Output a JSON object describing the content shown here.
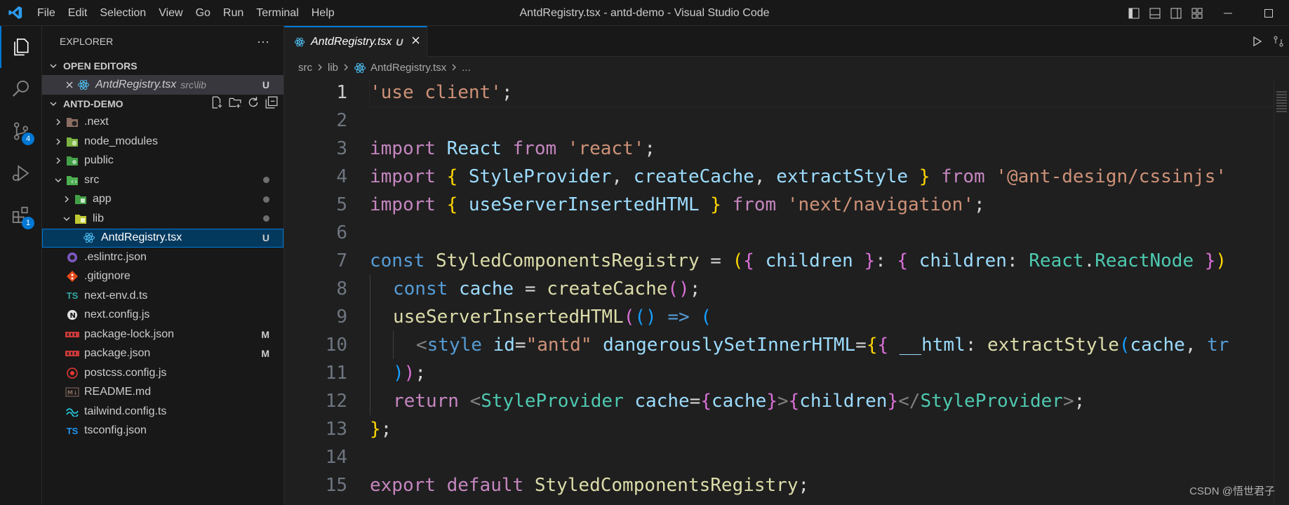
{
  "window": {
    "title": "AntdRegistry.tsx - antd-demo - Visual Studio Code",
    "menu": [
      "File",
      "Edit",
      "Selection",
      "View",
      "Go",
      "Run",
      "Terminal",
      "Help"
    ]
  },
  "activity_bar": {
    "items": [
      {
        "name": "explorer",
        "active": true,
        "badge": ""
      },
      {
        "name": "search",
        "active": false,
        "badge": ""
      },
      {
        "name": "source-control",
        "active": false,
        "badge": "4"
      },
      {
        "name": "run-debug",
        "active": false,
        "badge": ""
      },
      {
        "name": "extensions",
        "active": false,
        "badge": "1"
      }
    ]
  },
  "sidebar": {
    "title": "EXPLORER",
    "more": "···",
    "open_editors": {
      "label": "OPEN EDITORS",
      "items": [
        {
          "name": "AntdRegistry.tsx",
          "path": "src\\lib",
          "status": "U"
        }
      ]
    },
    "project": {
      "label": "ANTD-DEMO",
      "items": [
        {
          "name": ".next",
          "level": 0,
          "type": "folder",
          "expanded": false,
          "icon": "next-folder-icon",
          "status": "",
          "dot": false
        },
        {
          "name": "node_modules",
          "level": 0,
          "type": "folder",
          "expanded": false,
          "icon": "node-folder-icon",
          "status": "",
          "dot": false
        },
        {
          "name": "public",
          "level": 0,
          "type": "folder",
          "expanded": false,
          "icon": "public-folder-icon",
          "status": "",
          "dot": false
        },
        {
          "name": "src",
          "level": 0,
          "type": "folder",
          "expanded": true,
          "icon": "src-folder-icon",
          "status": "",
          "dot": true
        },
        {
          "name": "app",
          "level": 1,
          "type": "folder",
          "expanded": false,
          "icon": "app-folder-icon",
          "status": "",
          "dot": true
        },
        {
          "name": "lib",
          "level": 1,
          "type": "folder",
          "expanded": true,
          "icon": "lib-folder-icon",
          "status": "",
          "dot": true
        },
        {
          "name": "AntdRegistry.tsx",
          "level": 2,
          "type": "file",
          "icon": "react-icon",
          "status": "U",
          "dot": false,
          "selected": true
        },
        {
          "name": ".eslintrc.json",
          "level": 0,
          "type": "file",
          "icon": "eslint-icon",
          "status": "",
          "dot": false
        },
        {
          "name": ".gitignore",
          "level": 0,
          "type": "file",
          "icon": "git-icon",
          "status": "",
          "dot": false
        },
        {
          "name": "next-env.d.ts",
          "level": 0,
          "type": "file",
          "icon": "typescript-icon",
          "status": "",
          "dot": false
        },
        {
          "name": "next.config.js",
          "level": 0,
          "type": "file",
          "icon": "next-icon",
          "status": "",
          "dot": false
        },
        {
          "name": "package-lock.json",
          "level": 0,
          "type": "file",
          "icon": "npm-icon",
          "status": "M",
          "dot": false
        },
        {
          "name": "package.json",
          "level": 0,
          "type": "file",
          "icon": "npm-icon",
          "status": "M",
          "dot": false
        },
        {
          "name": "postcss.config.js",
          "level": 0,
          "type": "file",
          "icon": "postcss-icon",
          "status": "",
          "dot": false
        },
        {
          "name": "README.md",
          "level": 0,
          "type": "file",
          "icon": "markdown-icon",
          "status": "",
          "dot": false
        },
        {
          "name": "tailwind.config.ts",
          "level": 0,
          "type": "file",
          "icon": "tailwind-icon",
          "status": "",
          "dot": false
        },
        {
          "name": "tsconfig.json",
          "level": 0,
          "type": "file",
          "icon": "tsconfig-icon",
          "status": "",
          "dot": false
        }
      ]
    }
  },
  "editor": {
    "tab": {
      "name": "AntdRegistry.tsx",
      "status": "U"
    },
    "breadcrumbs": [
      "src",
      "lib",
      "AntdRegistry.tsx",
      "..."
    ],
    "current_line": 1,
    "lines": [
      {
        "n": "1",
        "tokens": [
          [
            "s",
            "'use client'"
          ],
          [
            "p",
            ";"
          ]
        ]
      },
      {
        "n": "2",
        "tokens": []
      },
      {
        "n": "3",
        "tokens": [
          [
            "k",
            "import"
          ],
          [
            "p",
            " "
          ],
          [
            "v",
            "React"
          ],
          [
            "p",
            " "
          ],
          [
            "k",
            "from"
          ],
          [
            "p",
            " "
          ],
          [
            "s",
            "'react'"
          ],
          [
            "p",
            ";"
          ]
        ]
      },
      {
        "n": "4",
        "tokens": [
          [
            "k",
            "import"
          ],
          [
            "p",
            " "
          ],
          [
            "br1",
            "{"
          ],
          [
            "p",
            " "
          ],
          [
            "v",
            "StyleProvider"
          ],
          [
            "p",
            ", "
          ],
          [
            "v",
            "createCache"
          ],
          [
            "p",
            ", "
          ],
          [
            "v",
            "extractStyle"
          ],
          [
            "p",
            " "
          ],
          [
            "br1",
            "}"
          ],
          [
            "p",
            " "
          ],
          [
            "k",
            "from"
          ],
          [
            "p",
            " "
          ],
          [
            "s",
            "'@ant-design/cssinjs'"
          ]
        ]
      },
      {
        "n": "5",
        "tokens": [
          [
            "k",
            "import"
          ],
          [
            "p",
            " "
          ],
          [
            "br1",
            "{"
          ],
          [
            "p",
            " "
          ],
          [
            "v",
            "useServerInsertedHTML"
          ],
          [
            "p",
            " "
          ],
          [
            "br1",
            "}"
          ],
          [
            "p",
            " "
          ],
          [
            "k",
            "from"
          ],
          [
            "p",
            " "
          ],
          [
            "s",
            "'next/navigation'"
          ],
          [
            "p",
            ";"
          ]
        ]
      },
      {
        "n": "6",
        "tokens": []
      },
      {
        "n": "7",
        "tokens": [
          [
            "b",
            "const"
          ],
          [
            "p",
            " "
          ],
          [
            "f",
            "StyledComponentsRegistry"
          ],
          [
            "p",
            " = "
          ],
          [
            "br1",
            "("
          ],
          [
            "br2",
            "{"
          ],
          [
            "p",
            " "
          ],
          [
            "v",
            "children"
          ],
          [
            "p",
            " "
          ],
          [
            "br2",
            "}"
          ],
          [
            "p",
            ": "
          ],
          [
            "br2",
            "{"
          ],
          [
            "p",
            " "
          ],
          [
            "v",
            "children"
          ],
          [
            "p",
            ": "
          ],
          [
            "t",
            "React"
          ],
          [
            "p",
            "."
          ],
          [
            "t",
            "ReactNode"
          ],
          [
            "p",
            " "
          ],
          [
            "br2",
            "}"
          ],
          [
            "br1",
            ")"
          ]
        ]
      },
      {
        "n": "8",
        "tokens": [
          [
            "ig",
            ""
          ],
          [
            "b",
            "const"
          ],
          [
            "p",
            " "
          ],
          [
            "v",
            "cache"
          ],
          [
            "p",
            " = "
          ],
          [
            "f",
            "createCache"
          ],
          [
            "br2",
            "()"
          ],
          [
            "p",
            ";"
          ]
        ]
      },
      {
        "n": "9",
        "tokens": [
          [
            "ig",
            ""
          ],
          [
            "f",
            "useServerInsertedHTML"
          ],
          [
            "br2",
            "("
          ],
          [
            "br3",
            "()"
          ],
          [
            "p",
            " "
          ],
          [
            "b",
            "=>"
          ],
          [
            "p",
            " "
          ],
          [
            "br3",
            "("
          ]
        ]
      },
      {
        "n": "10",
        "tokens": [
          [
            "ig",
            ""
          ],
          [
            "ig",
            ""
          ],
          [
            "tag",
            "<"
          ],
          [
            "b",
            "style"
          ],
          [
            "p",
            " "
          ],
          [
            "v",
            "id"
          ],
          [
            "p",
            "="
          ],
          [
            "s",
            "\"antd\""
          ],
          [
            "p",
            " "
          ],
          [
            "v",
            "dangerouslySetInnerHTML"
          ],
          [
            "p",
            "="
          ],
          [
            "br1",
            "{"
          ],
          [
            "br2",
            "{"
          ],
          [
            "p",
            " "
          ],
          [
            "v",
            "__html"
          ],
          [
            "p",
            ": "
          ],
          [
            "f",
            "extractStyle"
          ],
          [
            "br3",
            "("
          ],
          [
            "v",
            "cache"
          ],
          [
            "p",
            ", "
          ],
          [
            "b",
            "tr"
          ]
        ]
      },
      {
        "n": "11",
        "tokens": [
          [
            "ig",
            ""
          ],
          [
            "br3",
            ")"
          ],
          [
            "br2",
            ")"
          ],
          [
            "p",
            ";"
          ]
        ]
      },
      {
        "n": "12",
        "tokens": [
          [
            "ig",
            ""
          ],
          [
            "k",
            "return"
          ],
          [
            "p",
            " "
          ],
          [
            "tag",
            "<"
          ],
          [
            "t",
            "StyleProvider"
          ],
          [
            "p",
            " "
          ],
          [
            "v",
            "cache"
          ],
          [
            "p",
            "="
          ],
          [
            "br2",
            "{"
          ],
          [
            "v",
            "cache"
          ],
          [
            "br2",
            "}"
          ],
          [
            "tag",
            ">"
          ],
          [
            "br2",
            "{"
          ],
          [
            "v",
            "children"
          ],
          [
            "br2",
            "}"
          ],
          [
            "tag",
            "</"
          ],
          [
            "t",
            "StyleProvider"
          ],
          [
            "tag",
            ">"
          ],
          [
            "p",
            ";"
          ]
        ]
      },
      {
        "n": "13",
        "tokens": [
          [
            "br1",
            "}"
          ],
          [
            "p",
            ";"
          ]
        ]
      },
      {
        "n": "14",
        "tokens": []
      },
      {
        "n": "15",
        "tokens": [
          [
            "k",
            "export"
          ],
          [
            "p",
            " "
          ],
          [
            "k",
            "default"
          ],
          [
            "p",
            " "
          ],
          [
            "f",
            "StyledComponentsRegistry"
          ],
          [
            "p",
            ";"
          ]
        ]
      }
    ]
  },
  "watermark": "CSDN @悟世君子"
}
